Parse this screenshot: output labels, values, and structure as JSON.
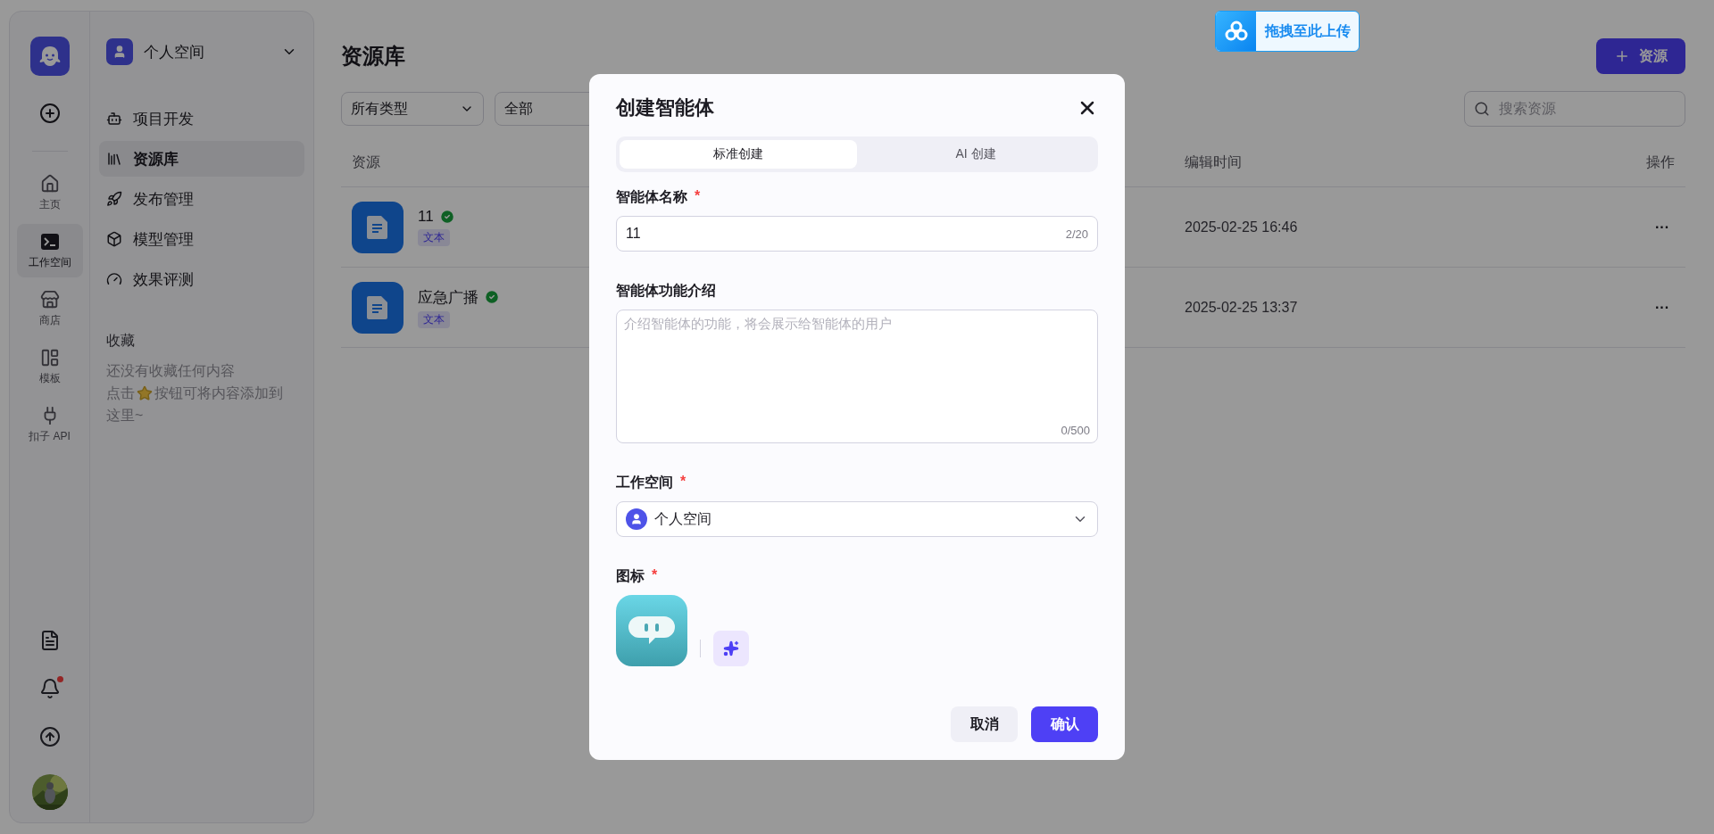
{
  "rail": {
    "items": [
      {
        "label": "主页",
        "kind": "home",
        "selected": false
      },
      {
        "label": "工作空间",
        "kind": "workspace",
        "selected": true
      },
      {
        "label": "商店",
        "kind": "store",
        "selected": false
      },
      {
        "label": "模板",
        "kind": "template",
        "selected": false
      },
      {
        "label": "扣子 API",
        "kind": "api",
        "selected": false
      }
    ],
    "notification_unread": true
  },
  "nav": {
    "space": "个人空间",
    "items": [
      {
        "label": "项目开发",
        "kind": "project",
        "selected": false
      },
      {
        "label": "资源库",
        "kind": "library",
        "selected": true
      },
      {
        "label": "发布管理",
        "kind": "publish",
        "selected": false
      },
      {
        "label": "模型管理",
        "kind": "model",
        "selected": false
      },
      {
        "label": "效果评测",
        "kind": "eval",
        "selected": false
      }
    ],
    "favorites_title": "收藏",
    "favorites_empty": "还没有收藏任何内容",
    "favorites_hint_before": "点击",
    "favorites_hint_after": "按钮可将内容添加到",
    "favorites_hint_end": "这里~"
  },
  "main": {
    "title": "资源库",
    "add_button": "资源",
    "filters": [
      {
        "label": "所有类型",
        "chevron": true
      },
      {
        "label": "全部"
      }
    ],
    "search": {
      "placeholder": "搜索资源"
    },
    "table": {
      "columns": [
        "资源",
        "编辑时间",
        "操作"
      ],
      "rows": [
        {
          "name": "11",
          "tag": "文本",
          "published": true,
          "edited": "2025-02-25 16:46",
          "menu": "···"
        },
        {
          "name": "应急广播",
          "tag": "文本",
          "published": true,
          "edited": "2025-02-25 13:37",
          "menu": "···"
        }
      ]
    }
  },
  "upload_widget": {
    "label": "拖拽至此上传"
  },
  "dialog": {
    "title": "创建智能体",
    "tabs": [
      {
        "label": "标准创建",
        "selected": true
      },
      {
        "label": "AI 创建",
        "selected": false
      }
    ],
    "name_field": {
      "label": "智能体名称",
      "required_mark": "*",
      "value": "11",
      "counter": "2/20"
    },
    "description_field": {
      "label": "智能体功能介绍",
      "placeholder": "介绍智能体的功能，将会展示给智能体的用户",
      "counter": "0/500"
    },
    "workspace_field": {
      "label": "工作空间",
      "required_mark": "*",
      "value": "个人空间"
    },
    "icon_field": {
      "label": "图标",
      "required_mark": "*"
    },
    "buttons": {
      "cancel": "取消",
      "confirm": "确认"
    }
  }
}
